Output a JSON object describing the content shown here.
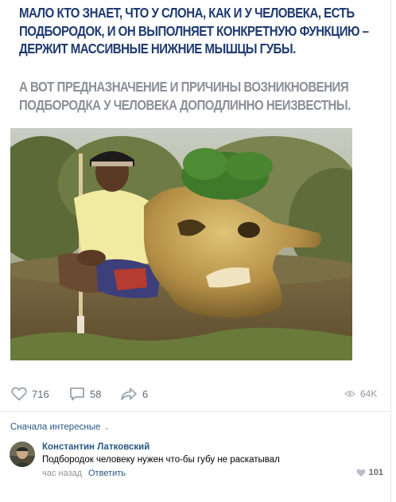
{
  "post": {
    "headline": "МАЛО КТО ЗНАЕТ, ЧТО У СЛОНА, КАК И У ЧЕЛОВЕКА, ЕСТЬ ПОДБОРОДОК, И ОН ВЫПОЛНЯЕТ КОНКРЕТНУЮ ФУНКЦИЮ – ДЕРЖИТ МАССИВНЫЕ НИЖНИЕ МЫШЦЫ ГУБЫ.",
    "subheadline": "А ВОТ ПРЕДНАЗНАЧЕНИЕ И ПРИЧИНЫ ВОЗНИКНОВЕНИЯ ПОДБОРОДКА У ЧЕЛОВЕКА ДОПОДЛИННО НЕИЗВЕСТНЫ.",
    "photo_icon": "man-with-elephant-skull-photo"
  },
  "actions": {
    "likes": "716",
    "comments": "58",
    "shares": "6",
    "views": "64K",
    "like_icon": "heart-icon",
    "comment_icon": "comment-bubble-icon",
    "share_icon": "share-arrow-icon",
    "views_icon": "eye-icon"
  },
  "comments_section": {
    "sort_label": "Сначала интересные",
    "sort_icon": "chevron-down-icon",
    "items": [
      {
        "author": "Константин Латковский",
        "text": "Подбородок человеку нужен что-бы губу не раскатывал",
        "time": "час назад",
        "reply_label": "Ответить",
        "likes": "101"
      }
    ]
  },
  "colors": {
    "headline": "#1f3a6f",
    "subheadline": "#8b8f98",
    "link": "#2a5885",
    "icon": "#99a2ad",
    "muted_text": "#656a73"
  }
}
